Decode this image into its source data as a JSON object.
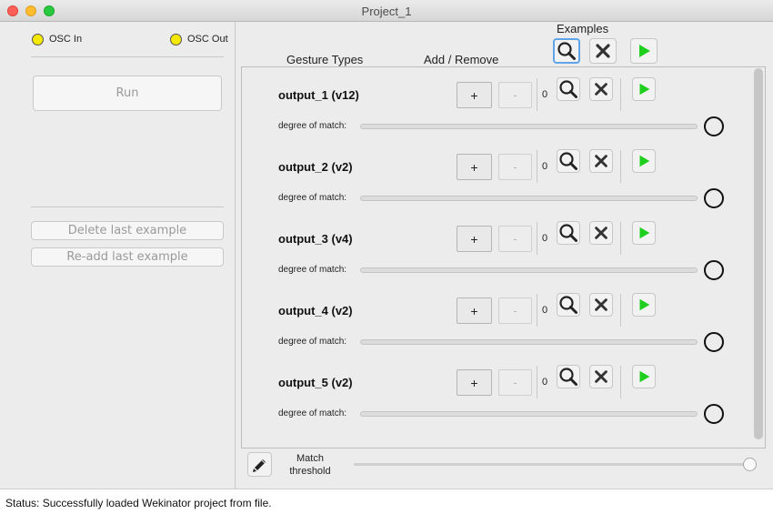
{
  "window": {
    "title": "Project_1"
  },
  "osc": {
    "in_label": "OSC In",
    "out_label": "OSC Out"
  },
  "left_panel": {
    "run_label": "Run",
    "delete_last_label": "Delete last example",
    "readd_last_label": "Re-add last example"
  },
  "headers": {
    "gesture_types": "Gesture Types",
    "add_remove": "Add / Remove",
    "examples": "Examples"
  },
  "outputs": [
    {
      "name": "output_1 (v12)",
      "plus": "+",
      "minus": "-",
      "count": "0",
      "match_label": "degree of match:"
    },
    {
      "name": "output_2 (v2)",
      "plus": "+",
      "minus": "-",
      "count": "0",
      "match_label": "degree of match:"
    },
    {
      "name": "output_3 (v4)",
      "plus": "+",
      "minus": "-",
      "count": "0",
      "match_label": "degree of match:"
    },
    {
      "name": "output_4 (v2)",
      "plus": "+",
      "minus": "-",
      "count": "0",
      "match_label": "degree of match:"
    },
    {
      "name": "output_5 (v2)",
      "plus": "+",
      "minus": "-",
      "count": "0",
      "match_label": "degree of match:"
    }
  ],
  "threshold": {
    "label_line1": "Match",
    "label_line2": "threshold",
    "value": 1.0
  },
  "status": {
    "text": "Status:  Successfully loaded Wekinator project from file."
  },
  "icons": {
    "search": "magnifier-icon",
    "delete": "x-icon",
    "play": "play-icon",
    "edit": "pencil-icon"
  },
  "colors": {
    "led": "#f5e800",
    "play": "#1ecf1e",
    "status_bg": "#ffffff"
  }
}
